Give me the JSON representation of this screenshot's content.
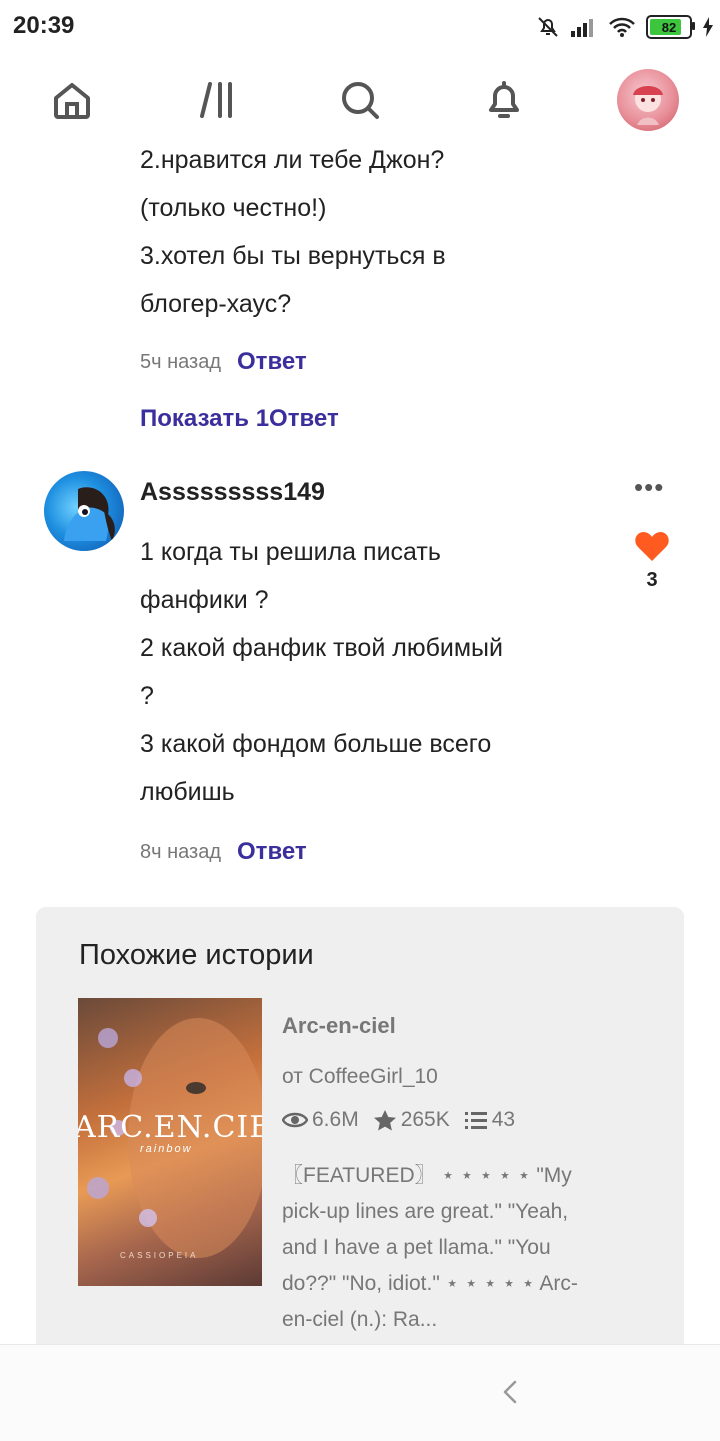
{
  "status_bar": {
    "time": "20:39",
    "battery": "82"
  },
  "comments": [
    {
      "lines": [
        "2.нравится ли тебе Джон?",
        "(только честно!)",
        "3.хотел бы ты вернуться в",
        "блогер-хаус?"
      ],
      "time": "5ч назад",
      "reply_label": "Ответ",
      "show_replies": "Показать 1Ответ"
    },
    {
      "username": "Asssssssss149",
      "lines": [
        "1 когда ты решила писать",
        "фанфики ?",
        "2 какой фанфик твой любимый",
        "?",
        "3 какой фондом больше всего",
        "любишь"
      ],
      "likes": "3",
      "time": "8ч назад",
      "reply_label": "Ответ"
    }
  ],
  "similar": {
    "heading": "Похожие истории",
    "book": {
      "cover_title": "ARC.EN.CIEL",
      "cover_subtitle": "rainbow",
      "cover_author": "CASSIOPEIA",
      "title": "Arc-en-ciel",
      "author": "от CoffeeGirl_10",
      "reads": "6.6M",
      "votes": "265K",
      "parts": "43",
      "description": "〖FEATURED〗 ⋆ ⋆ ⋆ ⋆ ⋆ \"My pick-up lines are great.\" \"Yeah, and I have a pet llama.\" \"You do??\" \"No, idiot.\" ⋆ ⋆ ⋆ ⋆ ⋆ Arc-en-ciel (n.): Ra..."
    }
  },
  "colors": {
    "accent": "#3a2f9c",
    "like": "#ff5a1f"
  }
}
